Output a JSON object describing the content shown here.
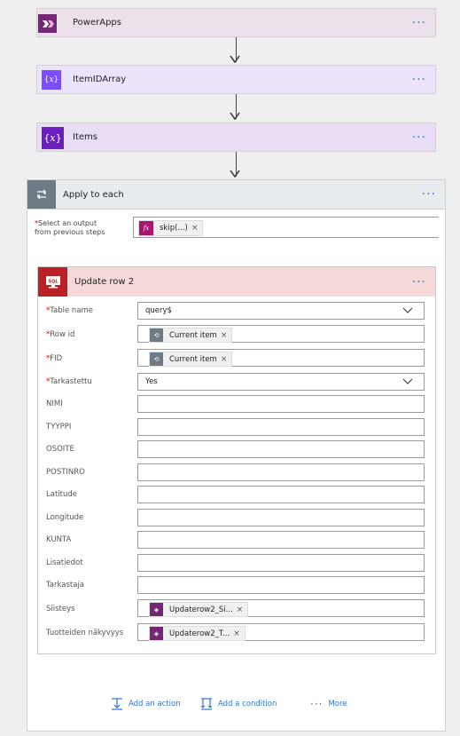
{
  "steps": {
    "powerapps": {
      "title": "PowerApps",
      "icon": "powerapps-icon",
      "color": "#742774"
    },
    "itemidarray": {
      "title": "ItemIDArray",
      "icon": "variable-icon",
      "color": "#7c4dff"
    },
    "items": {
      "title": "Items",
      "icon": "variable-icon",
      "color": "#6b1fbf"
    }
  },
  "apply_each": {
    "title": "Apply to each",
    "select_label": "Select an output",
    "select_label2": "from previous steps",
    "token": "skip(...)",
    "token_remove": "×"
  },
  "update_row": {
    "title": "Update row 2",
    "icon_label": "SQL",
    "fields": {
      "table_name": {
        "label": "Table name",
        "value": "query$"
      },
      "row_id": {
        "label": "Row id",
        "token": "Current item"
      },
      "fid": {
        "label": "FID",
        "token": "Current item"
      },
      "tarkastettu": {
        "label": "Tarkastettu",
        "value": "Yes"
      },
      "nimi": {
        "label": "NIMI"
      },
      "tyyppi": {
        "label": "TYYPPI"
      },
      "osoite": {
        "label": "OSOITE"
      },
      "postinro": {
        "label": "POSTINRO"
      },
      "latitude": {
        "label": "Latitude"
      },
      "longitude": {
        "label": "Longitude"
      },
      "kunta": {
        "label": "KUNTA"
      },
      "lisatiedot": {
        "label": "Lisatiedot"
      },
      "tarkastaja": {
        "label": "Tarkastaja"
      },
      "siisteys": {
        "label": "Siisteys",
        "token": "Updaterow2_Si..."
      },
      "tuotteiden": {
        "label": "Tuotteiden näkyvyys",
        "token": "Updaterow2_T..."
      }
    },
    "required_mark": "*",
    "remove": "×"
  },
  "footer": {
    "add_action": "Add an action",
    "add_condition": "Add a condition",
    "more": "More"
  },
  "more_dots": "···"
}
